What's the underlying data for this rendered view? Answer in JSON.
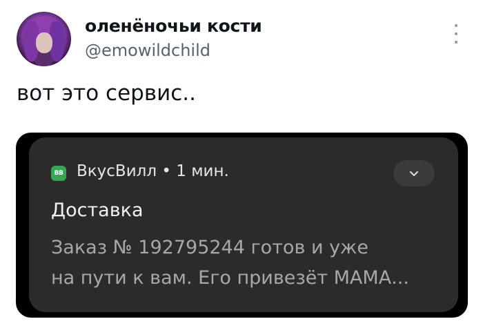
{
  "author": {
    "display_name": "оленёночьи кости",
    "handle": "@emowildchild"
  },
  "tweet": {
    "text": "вот это сервис.."
  },
  "notification": {
    "app_badge": "ВВ",
    "app_name": "ВкусВилл",
    "separator": "•",
    "time": "1 мин.",
    "title": "Доставка",
    "body_line1": "Заказ № 192795244 готов и уже",
    "body_line2": "на пути к вам. Его привезёт МАМА..."
  },
  "icons": {
    "more": "more-vertical-icon",
    "expand": "chevron-down-icon",
    "app": "vkusvill-app-icon"
  },
  "colors": {
    "app_green": "#34a853",
    "notification_bg": "#2b2b2b",
    "handle_gray": "#536471"
  }
}
